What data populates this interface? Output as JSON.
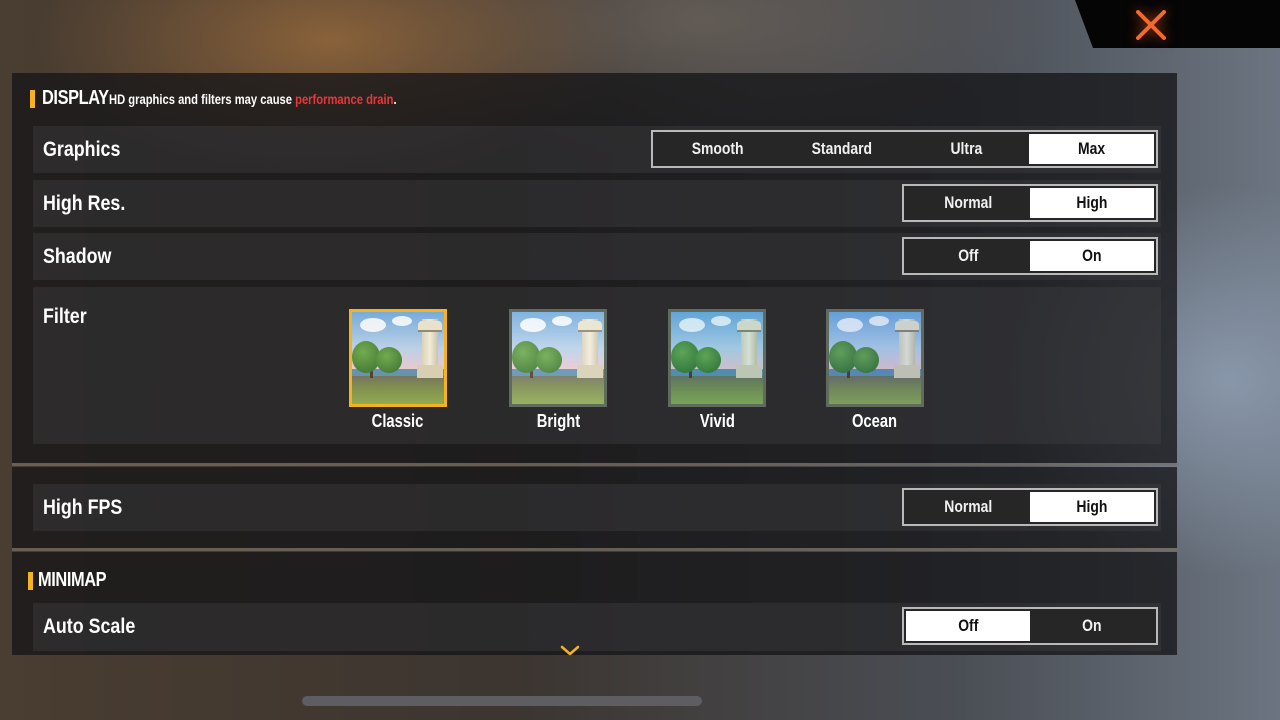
{
  "close_button": {
    "icon": "close-icon",
    "color": "#f26a2e"
  },
  "display": {
    "title": "DISPLAY",
    "note_prefix": "HD graphics and filters may cause ",
    "note_warning": "performance drain",
    "note_suffix": ".",
    "accent_color": "#f5b321",
    "warning_color": "#e8383b",
    "graphics": {
      "label": "Graphics",
      "options": [
        "Smooth",
        "Standard",
        "Ultra",
        "Max"
      ],
      "selected": "Max"
    },
    "high_res": {
      "label": "High Res.",
      "options": [
        "Normal",
        "High"
      ],
      "selected": "High"
    },
    "shadow": {
      "label": "Shadow",
      "options": [
        "Off",
        "On"
      ],
      "selected": "On"
    },
    "filter": {
      "label": "Filter",
      "options": [
        {
          "name": "Classic",
          "icon": "filter-classic-thumbnail"
        },
        {
          "name": "Bright",
          "icon": "filter-bright-thumbnail"
        },
        {
          "name": "Vivid",
          "icon": "filter-vivid-thumbnail"
        },
        {
          "name": "Ocean",
          "icon": "filter-ocean-thumbnail"
        }
      ],
      "selected": "Classic"
    }
  },
  "high_fps": {
    "label": "High FPS",
    "options": [
      "Normal",
      "High"
    ],
    "selected": "High"
  },
  "minimap": {
    "title": "MINIMAP",
    "auto_scale": {
      "label": "Auto Scale",
      "options": [
        "Off",
        "On"
      ],
      "selected": "Off"
    }
  },
  "scroll_indicator": {
    "icon": "chevron-down-icon",
    "color": "#f5b321"
  }
}
